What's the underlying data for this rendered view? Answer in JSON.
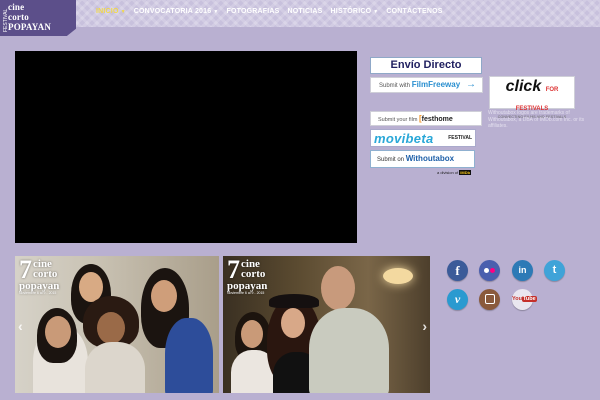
{
  "logo": {
    "festival": "FESTIVAL",
    "lines": [
      "cine",
      "corto",
      "POPAYAN"
    ]
  },
  "nav": {
    "items": [
      {
        "label": "INICIO",
        "dropdown": true,
        "active": true
      },
      {
        "label": "CONVOCATORIA 2016",
        "dropdown": true,
        "active": false
      },
      {
        "label": "FOTOGRAFIAS",
        "dropdown": false,
        "active": false
      },
      {
        "label": "NOTICIAS",
        "dropdown": false,
        "active": false
      },
      {
        "label": "HISTÓRICO",
        "dropdown": true,
        "active": false
      },
      {
        "label": "CONTÁCTENOS",
        "dropdown": false,
        "active": false
      }
    ]
  },
  "submissions": {
    "envio": "Envío Directo",
    "filmfreeway_prefix": "Submit with",
    "filmfreeway_name": "FilmFreeway",
    "click_big": "click",
    "click_for": "FOR FESTIVALS",
    "click_tag": "CONNECTING FILMS AND FESTIVALS",
    "festhome_prefix": "Submit your film",
    "festhome_name": "festhome",
    "movibeta": "movibeta",
    "movibeta_festival": "FESTIVAL",
    "withoutabox_prefix": "Submit on",
    "withoutabox_name": "Withoutabox",
    "imdb_prefix": "a division of",
    "imdb": "IMDb",
    "disclaimer": "Withoutabox logos are trademarks of Withoutabox, a DBA of IMDb.com Inc. or its affiliates."
  },
  "gallery": {
    "logo_number": "7",
    "logo_lines": [
      "cine",
      "corto",
      "popayan"
    ],
    "logo_sub": "Noviembre 6 al 9 - 2015",
    "prev": "‹",
    "next": "›"
  },
  "social": {
    "facebook": "f",
    "linkedin": "in",
    "twitter": "t",
    "vimeo": "v",
    "youtube_you": "You",
    "youtube_tube": "Tube"
  },
  "colors": {
    "background": "#b9b0d1",
    "logo_bg": "#5c4f8a",
    "nav_active": "#f2d94a"
  }
}
